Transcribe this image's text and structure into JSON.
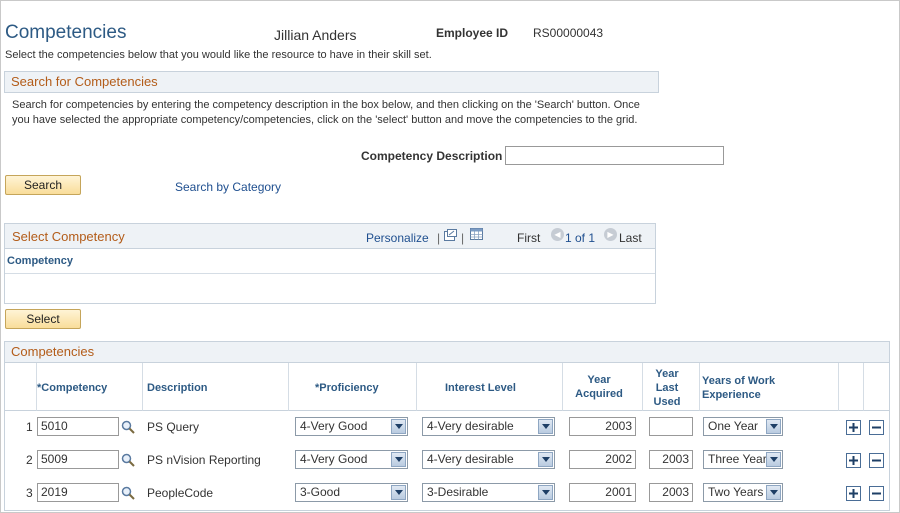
{
  "header": {
    "title": "Competencies",
    "employee_name": "Jillian Anders",
    "employee_id_label": "Employee ID",
    "employee_id": "RS00000043",
    "intro": "Select the competencies below that you would like the resource to have in their skill set."
  },
  "search": {
    "section_title": "Search for Competencies",
    "help_text": "Search for competencies by entering the competency description in the box below, and then clicking on the 'Search' button. Once you have selected the appropriate competency/competencies, click on the 'select' button and move the competencies to the grid.",
    "description_label": "Competency Description",
    "description_value": "",
    "search_button": "Search",
    "category_link": "Search by Category"
  },
  "select_grid": {
    "title": "Select Competency",
    "personalize": "Personalize",
    "separator": "|",
    "first": "First",
    "count": "1 of 1",
    "last": "Last",
    "column": "Competency",
    "select_button": "Select"
  },
  "competencies": {
    "title": "Competencies",
    "columns": {
      "competency": "*Competency",
      "description": "Description",
      "proficiency": "*Proficiency",
      "interest": "Interest Level",
      "year_acquired": "Year Acquired",
      "year_last_used": "Year Last Used",
      "years_experience": "Years of Work Experience"
    },
    "rows": [
      {
        "num": "1",
        "competency": "5010",
        "description": "PS Query",
        "proficiency": "4-Very Good",
        "interest": "4-Very desirable",
        "year_acquired": "2003",
        "year_last_used": "",
        "years_experience": "One Year"
      },
      {
        "num": "2",
        "competency": "5009",
        "description": "PS nVision Reporting",
        "proficiency": "4-Very Good",
        "interest": "4-Very desirable",
        "year_acquired": "2002",
        "year_last_used": "2003",
        "years_experience": "Three Year"
      },
      {
        "num": "3",
        "competency": "2019",
        "description": "PeopleCode",
        "proficiency": "3-Good",
        "interest": "3-Desirable",
        "year_acquired": "2001",
        "year_last_used": "2003",
        "years_experience": "Two Years"
      }
    ]
  },
  "icons": {
    "lookup": "magnifier-icon",
    "add": "plus-icon",
    "delete": "minus-icon",
    "zoom": "new-window-icon",
    "download": "spreadsheet-icon",
    "prev": "arrow-left-icon",
    "next": "arrow-right-icon",
    "dropdown": "chevron-down-icon"
  },
  "colors": {
    "title_blue": "#2d5a84",
    "section_orange": "#b35c19",
    "link_blue": "#1f4f8f",
    "button_gold": "#f9dd9a"
  }
}
